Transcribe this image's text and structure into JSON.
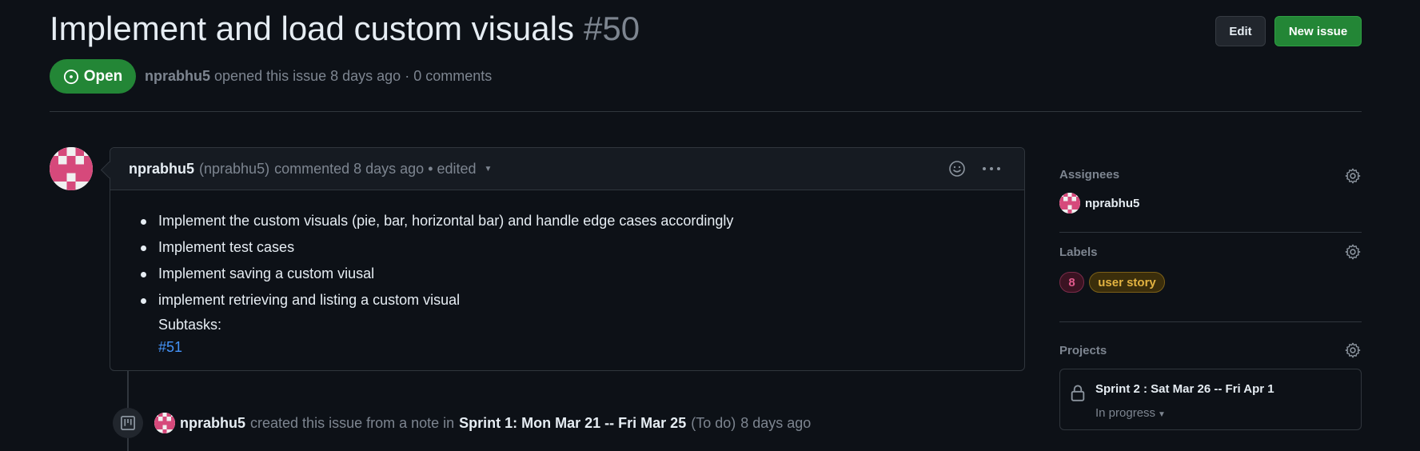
{
  "issue": {
    "title": "Implement and load custom visuals",
    "number": "#50",
    "state": "Open",
    "author": "nprabhu5",
    "meta_text": "opened this issue 8 days ago · 0 comments"
  },
  "header": {
    "edit_label": "Edit",
    "new_issue_label": "New issue"
  },
  "comment": {
    "author": "nprabhu5",
    "handle": "(nprabhu5)",
    "meta": "commented 8 days ago • edited",
    "items": [
      "Implement the custom visuals (pie, bar, horizontal bar) and handle edge cases accordingly",
      "Implement test cases",
      "Implement saving a custom viusal",
      "implement retrieving and listing a custom visual"
    ],
    "subtasks_label": "Subtasks:",
    "subtask_link": "#51"
  },
  "timeline": {
    "actor": "nprabhu5",
    "text_before": "created this issue from a note in",
    "project": "Sprint 1: Mon Mar 21 -- Fri Mar 25",
    "column": "(To do)",
    "time": "8 days ago"
  },
  "sidebar": {
    "assignees": {
      "label": "Assignees",
      "user": "nprabhu5"
    },
    "labels": {
      "label": "Labels",
      "items": [
        {
          "name": "8",
          "color": "#e0598b"
        },
        {
          "name": "user story",
          "color": "#e3b341"
        }
      ]
    },
    "projects": {
      "label": "Projects",
      "name": "Sprint 2 : Sat Mar 26 -- Fri Apr 1",
      "status": "In progress"
    }
  },
  "colors": {
    "background": "#0d1117",
    "open_green": "#238636",
    "link_blue": "#4493f8",
    "muted": "#7d8590"
  }
}
